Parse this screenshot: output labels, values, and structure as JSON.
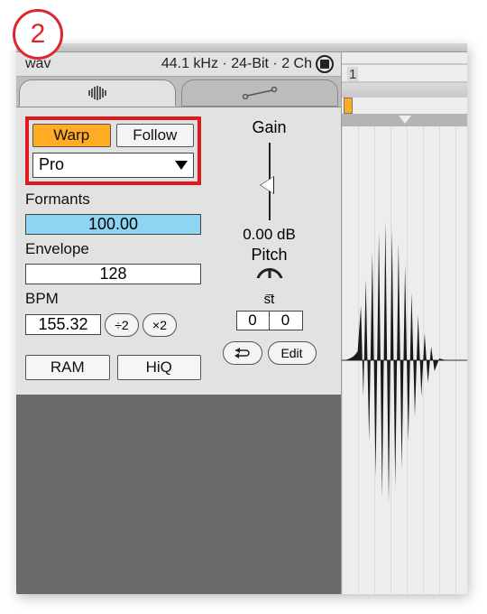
{
  "step_number": "2",
  "status": {
    "file_ext": "wav",
    "info": "44.1 kHz · 24-Bit · 2 Ch"
  },
  "warp": {
    "warp_label": "Warp",
    "follow_label": "Follow",
    "mode": "Pro"
  },
  "formants": {
    "label": "Formants",
    "value": "100.00"
  },
  "envelope": {
    "label": "Envelope",
    "value": "128"
  },
  "bpm": {
    "label": "BPM",
    "value": "155.32",
    "div2": "÷2",
    "mul2": "×2"
  },
  "buttons": {
    "ram": "RAM",
    "hiq": "HiQ",
    "edit": "Edit"
  },
  "gain": {
    "label": "Gain",
    "db": "0.00 dB"
  },
  "pitch": {
    "label": "Pitch",
    "unit": "st",
    "semi": "0",
    "cents": "0"
  },
  "timeline": {
    "marker": "1"
  }
}
